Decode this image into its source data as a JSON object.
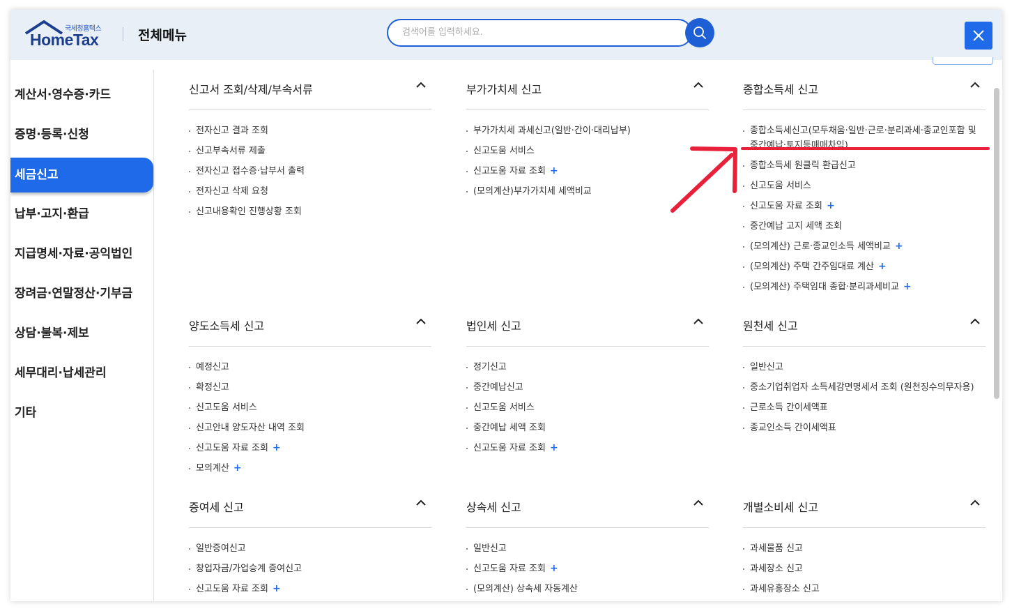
{
  "header": {
    "logo_small": "국세청홈택스",
    "logo_main": "HomeTax",
    "title": "전체메뉴",
    "search_placeholder": "검색어를 입력하세요."
  },
  "sidebar": {
    "items": [
      {
        "label": "계산서·영수증·카드"
      },
      {
        "label": "증명·등록·신청"
      },
      {
        "label": "세금신고",
        "active": true
      },
      {
        "label": "납부·고지·환급"
      },
      {
        "label": "지급명세·자료·공익법인"
      },
      {
        "label": "장려금·연말정산·기부금"
      },
      {
        "label": "상담·불복·제보"
      },
      {
        "label": "세무대리·납세관리"
      },
      {
        "label": "기타"
      }
    ]
  },
  "sections": [
    {
      "title": "신고서 조회/삭제/부속서류",
      "items": [
        {
          "label": "전자신고 결과 조회"
        },
        {
          "label": "신고부속서류 제출"
        },
        {
          "label": "전자신고 접수증·납부서 출력"
        },
        {
          "label": "전자신고 삭제 요청"
        },
        {
          "label": "신고내용확인 진행상황 조회"
        }
      ]
    },
    {
      "title": "부가가치세 신고",
      "items": [
        {
          "label": "부가가치세 과세신고(일반·간이·대리납부)"
        },
        {
          "label": "신고도움 서비스"
        },
        {
          "label": "신고도움 자료 조회",
          "plus": "+"
        },
        {
          "label": "(모의계산)부가가치세 세액비교"
        }
      ]
    },
    {
      "title": "종합소득세 신고",
      "items": [
        {
          "label": "종합소득세신고(모두채움·일반·근로·분리과세·종교인포함 및 중간예납·토지등매매차익)"
        },
        {
          "label": "종합소득세 원클릭 환급신고"
        },
        {
          "label": "신고도움 서비스"
        },
        {
          "label": "신고도움 자료 조회",
          "plus": "+"
        },
        {
          "label": "중간예납 고지 세액 조회"
        },
        {
          "label": "(모의계산) 근로·종교인소득 세액비교",
          "plus": "+"
        },
        {
          "label": "(모의계산) 주택 간주임대료 계산",
          "plus": "+"
        },
        {
          "label": "(모의계산) 주택임대 종합·분리과세비교",
          "plus": "+"
        }
      ]
    },
    {
      "title": "양도소득세 신고",
      "items": [
        {
          "label": "예정신고"
        },
        {
          "label": "확정신고"
        },
        {
          "label": "신고도움 서비스"
        },
        {
          "label": "신고안내 양도자산 내역 조회"
        },
        {
          "label": "신고도움 자료 조회",
          "plus": "+"
        },
        {
          "label": "모의계산",
          "plus": "+"
        }
      ]
    },
    {
      "title": "법인세 신고",
      "items": [
        {
          "label": "정기신고"
        },
        {
          "label": "중간예납신고"
        },
        {
          "label": "신고도움 서비스"
        },
        {
          "label": "중간예납 세액 조회"
        },
        {
          "label": "신고도움 자료 조회",
          "plus": "+"
        }
      ]
    },
    {
      "title": "원천세 신고",
      "items": [
        {
          "label": "일반신고"
        },
        {
          "label": "중소기업취업자 소득세감면명세서 조회 (원천징수의무자용)"
        },
        {
          "label": "근로소득 간이세액표"
        },
        {
          "label": "종교인소득 간이세액표"
        }
      ]
    },
    {
      "title": "증여세 신고",
      "items": [
        {
          "label": "일반증여신고"
        },
        {
          "label": "창업자금/가업승계 증여신고"
        },
        {
          "label": "신고도움 자료 조회",
          "plus": "+"
        }
      ]
    },
    {
      "title": "상속세 신고",
      "items": [
        {
          "label": "일반신고"
        },
        {
          "label": "신고도움 자료 조회",
          "plus": "+"
        },
        {
          "label": "(모의계산) 상속세 자동계산"
        }
      ]
    },
    {
      "title": "개별소비세 신고",
      "items": [
        {
          "label": "과세물품 신고"
        },
        {
          "label": "과세장소 신고"
        },
        {
          "label": "과세유흥장소 신고"
        }
      ]
    }
  ],
  "colors": {
    "accent": "#1f6ae8",
    "annotation": "#e8203a",
    "header_bg": "#e9eff7"
  }
}
